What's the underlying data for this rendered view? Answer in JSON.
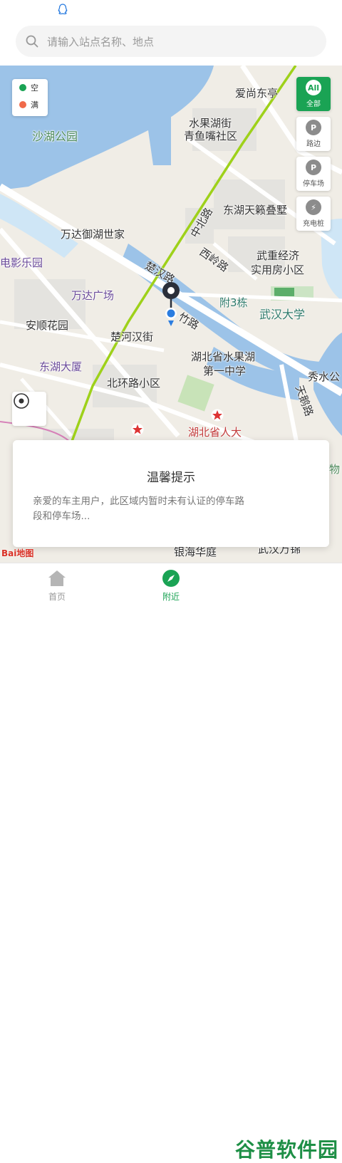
{
  "search": {
    "placeholder": "请输入站点名称、地点"
  },
  "legend": [
    {
      "label": "空",
      "color": "#1aa354"
    },
    {
      "label": "满",
      "color": "#f06a4a"
    }
  ],
  "filters": [
    {
      "icon": "All",
      "label": "全部",
      "active": true
    },
    {
      "icon": "P",
      "label": "路边",
      "active": false
    },
    {
      "icon": "P",
      "label": "停车场",
      "active": false
    },
    {
      "icon": "⚡",
      "label": "充电桩",
      "active": false
    }
  ],
  "map_labels": {
    "l1": "爱尚东亭",
    "l2": "水果湖街",
    "l3": "青鱼嘴社区",
    "l4": "沙湖公园",
    "l5": "东湖天籁叠墅",
    "l6": "万达御湖世家",
    "l7": "电影乐园",
    "l8": "武重经济",
    "l9": "实用房小区",
    "l10": "万达广场",
    "l11": "附3栋",
    "l12": "武汉大学",
    "l13": "安顺花园",
    "l14": "楚河汉街",
    "l15": "湖北省水果湖",
    "l16": "第一中学",
    "l17": "东湖大厦",
    "l18": "北环路小区",
    "l19": "秀水公",
    "l20": "湖北省人大",
    "l21": "银海华庭",
    "l22": "武汉万锦",
    "road1": "中北路",
    "road2": "西岭路",
    "road3": "楚汉路",
    "road4": "竹路",
    "road5": "天鹅路",
    "road6": "物"
  },
  "dialog": {
    "title": "温馨提示",
    "message": "亲爱的车主用户，此区域内暂时未有认证的停车路段和停车场..."
  },
  "baidu": "Bai地图",
  "tabs": [
    {
      "label": "首页",
      "active": false
    },
    {
      "label": "附近",
      "active": true
    }
  ],
  "watermark": "谷普软件园"
}
